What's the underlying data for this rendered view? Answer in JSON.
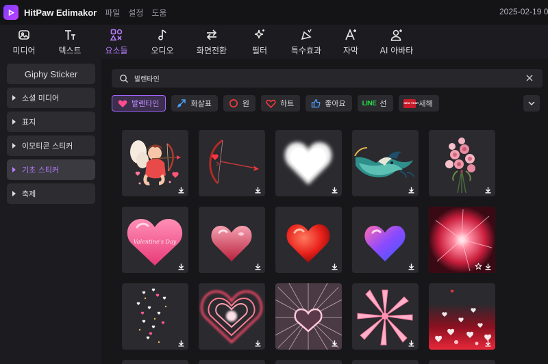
{
  "titlebar": {
    "app_title": "HitPaw Edimakor",
    "menu": [
      "파일",
      "설정",
      "도움"
    ],
    "datetime": "2025-02-19 0"
  },
  "toolbar": {
    "active": "elements",
    "items": [
      {
        "id": "media",
        "label": "미디어",
        "icon": "media-icon"
      },
      {
        "id": "text",
        "label": "텍스트",
        "icon": "text-icon"
      },
      {
        "id": "elements",
        "label": "요소들",
        "icon": "elements-icon"
      },
      {
        "id": "audio",
        "label": "오디오",
        "icon": "music-note-icon"
      },
      {
        "id": "transition",
        "label": "화면전환",
        "icon": "transition-arrows-icon"
      },
      {
        "id": "filter",
        "label": "필터",
        "icon": "sparkle-icon"
      },
      {
        "id": "effects",
        "label": "특수효과",
        "icon": "effects-icon"
      },
      {
        "id": "subtitle",
        "label": "자막",
        "icon": "subtitle-icon"
      },
      {
        "id": "avatar",
        "label": "AI 아바타",
        "icon": "ai-avatar-icon"
      }
    ]
  },
  "sidebar": {
    "top_label": "Giphy Sticker",
    "items": [
      {
        "label": "소셜 미디어",
        "active": false
      },
      {
        "label": "표지",
        "active": false
      },
      {
        "label": "이모티콘 스티커",
        "active": false
      },
      {
        "label": "기초 스티커",
        "active": true
      },
      {
        "label": "축제",
        "active": false
      }
    ]
  },
  "search": {
    "value": "발렌타인",
    "icon": "search-icon"
  },
  "chips": [
    {
      "label": "발렌타인",
      "icon": "heart-badge-icon",
      "active": true
    },
    {
      "label": "화살표",
      "icon": "arrow-icon",
      "active": false
    },
    {
      "label": "원",
      "icon": "circle-icon",
      "active": false
    },
    {
      "label": "하트",
      "icon": "heart-outline-icon",
      "active": false
    },
    {
      "label": "좋아요",
      "icon": "thumbs-up-icon",
      "active": false
    },
    {
      "label": "선",
      "icon": "line-logo-icon",
      "active": false,
      "icon_text": "LINE"
    },
    {
      "label": "새해",
      "icon": "new-year-icon",
      "active": false,
      "icon_text": "NEW YEAR"
    }
  ],
  "stickers": [
    {
      "name": "cupid-sticker"
    },
    {
      "name": "bow-arrow-sticker"
    },
    {
      "name": "cloud-heart-sticker"
    },
    {
      "name": "dragon-sticker"
    },
    {
      "name": "rose-bouquet-sticker"
    },
    {
      "name": "valentine-heart-sticker",
      "text": "Valentine's Day"
    },
    {
      "name": "glass-heart-sticker"
    },
    {
      "name": "red-glossy-heart-sticker"
    },
    {
      "name": "purple-heart-sticker"
    },
    {
      "name": "pink-burst-sticker",
      "favorite": true
    },
    {
      "name": "floating-hearts-sticker"
    },
    {
      "name": "neon-heart-sticker"
    },
    {
      "name": "sparkle-heart-sticker"
    },
    {
      "name": "pink-ribbon-sticker"
    },
    {
      "name": "red-bokeh-hearts-sticker"
    }
  ],
  "colors": {
    "accent": "#b77dff",
    "background": "#16161a",
    "panel": "#1c1c20",
    "tile": "#2a2a2f"
  }
}
